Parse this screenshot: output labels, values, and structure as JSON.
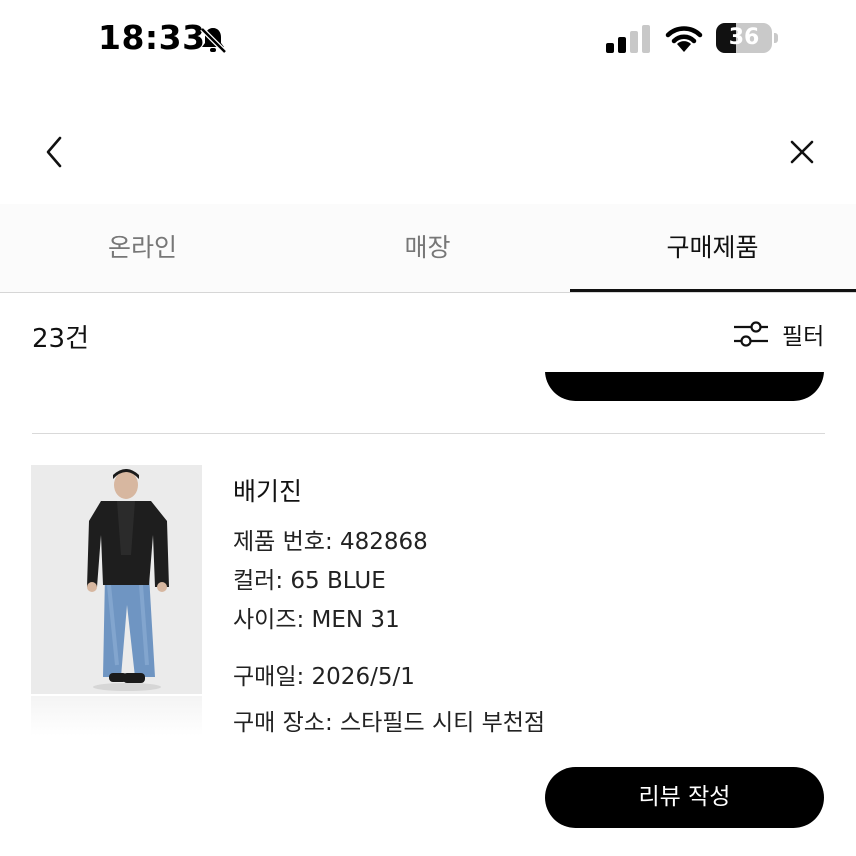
{
  "status_bar": {
    "time": "18:33",
    "battery_level": "36",
    "icons": [
      "bell-slash-icon",
      "signal-icon",
      "wifi-icon",
      "battery-icon"
    ]
  },
  "nav": {
    "icons": [
      "chevron-left-icon",
      "close-icon"
    ]
  },
  "tabs": [
    {
      "label": "온라인",
      "active": false
    },
    {
      "label": "매장",
      "active": false
    },
    {
      "label": "구매제품",
      "active": true
    }
  ],
  "list": {
    "count_label": "23건",
    "filter_label": "필터",
    "filter_icon": "sliders-icon"
  },
  "product": {
    "name": "배기진",
    "product_number": "제품 번호: 482868",
    "color": "컬러: 65 BLUE",
    "size": "사이즈: MEN 31",
    "purchase_date": "구매일: 2026/5/1",
    "purchase_place": "구매 장소: 스타필드 시티 부천점",
    "review_button": "리뷰 작성"
  },
  "colors": {
    "accent": "#000000",
    "tab_inactive": "#777777",
    "tab_bar_bg": "#fbfbfb",
    "divider": "#d9d9d9"
  }
}
